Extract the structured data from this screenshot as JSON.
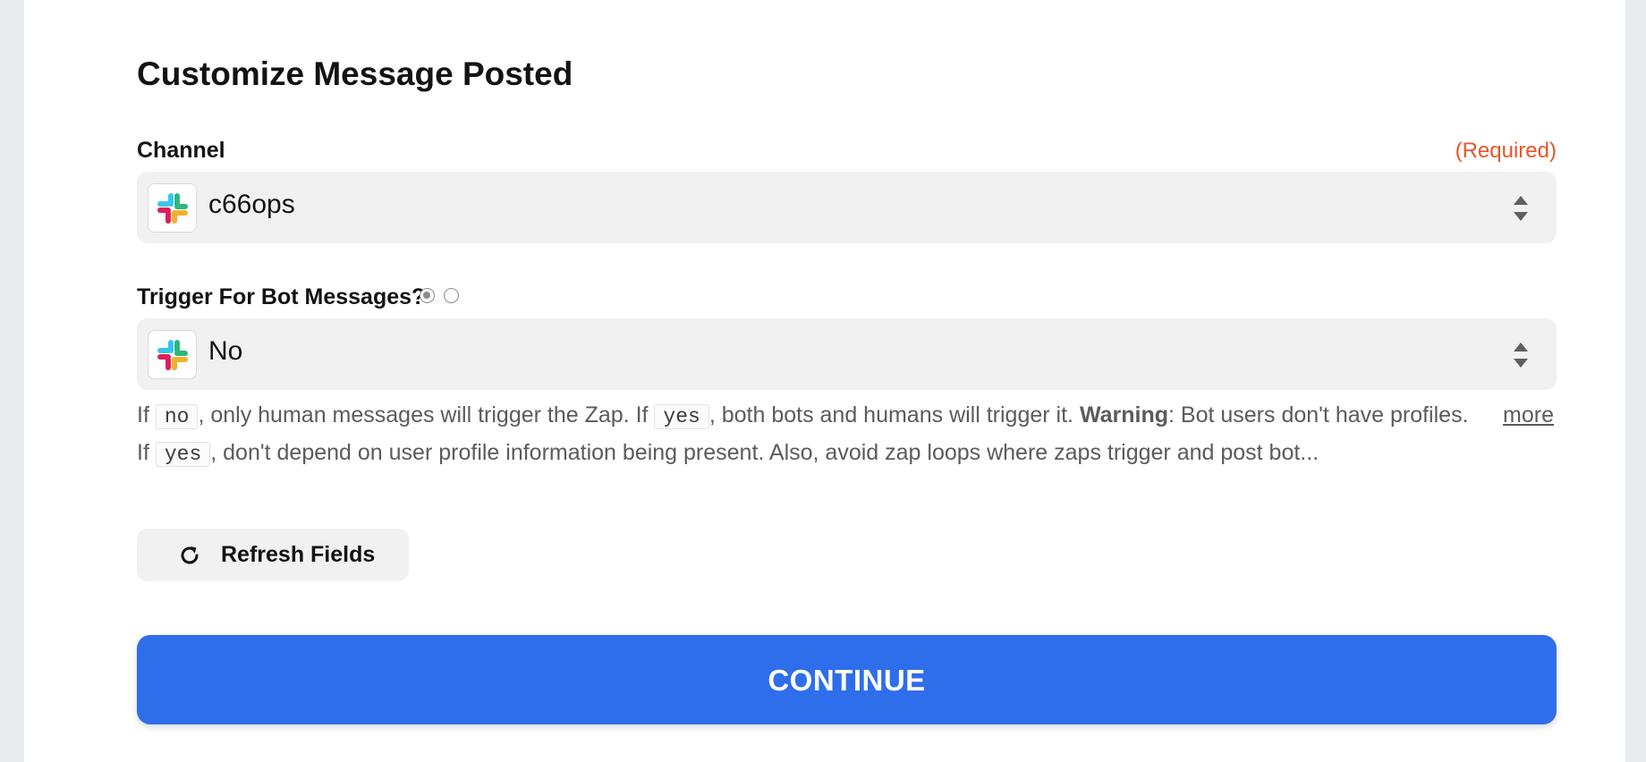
{
  "section": {
    "title": "Customize Message Posted"
  },
  "channel": {
    "label": "Channel",
    "required_text": "(Required)",
    "value": "c66ops",
    "app_icon": "slack-icon"
  },
  "bot_trigger": {
    "label": "Trigger For Bot Messages?",
    "value": "No",
    "app_icon": "slack-icon",
    "radio_selected": 0
  },
  "help": {
    "t1": "If ",
    "code_no": "no",
    "t2": ", only human messages will trigger the Zap. If ",
    "code_yes": "yes",
    "t3": ", both bots and humans will trigger it. ",
    "warning": "Warning",
    "t4": ": Bot users don't have profiles. If ",
    "code_yes2": "yes",
    "t5": ", don't depend on user profile information being present. Also, avoid zap loops where zaps trigger and post bot...",
    "more_label": "more"
  },
  "refresh": {
    "label": "Refresh Fields",
    "icon": "refresh-icon"
  },
  "continue": {
    "label": "CONTINUE"
  },
  "colors": {
    "accent": "#2f6eeb",
    "required": "#e8552a",
    "field_bg": "#f1f1f1"
  }
}
